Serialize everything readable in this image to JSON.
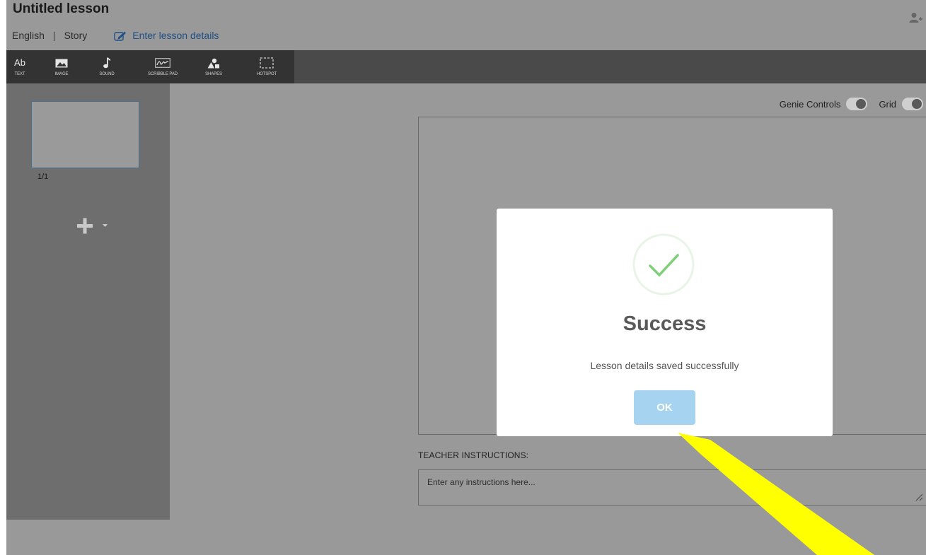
{
  "lesson": {
    "title": "Untitled lesson",
    "language": "English",
    "separator": "|",
    "type": "Story",
    "details_link": "Enter lesson details"
  },
  "toolbar": {
    "text_glyph": "Ab",
    "tools": [
      {
        "label": "TEXT",
        "icon": "text-icon"
      },
      {
        "label": "IMAGE",
        "icon": "image-icon"
      },
      {
        "label": "SOUND",
        "icon": "music-note-icon"
      },
      {
        "label": "SCRIBBLE PAD",
        "icon": "scribble-pad-icon"
      },
      {
        "label": "SHAPES",
        "icon": "shapes-icon"
      },
      {
        "label": "HOTSPOT",
        "icon": "hotspot-icon"
      }
    ]
  },
  "slides": {
    "page_indicator": "1/1"
  },
  "controls": {
    "genie_controls_label": "Genie Controls",
    "grid_label": "Grid"
  },
  "teacher": {
    "label": "TEACHER INSTRUCTIONS:",
    "placeholder": "Enter any instructions here..."
  },
  "dialog": {
    "title": "Success",
    "message": "Lesson details saved successfully",
    "ok_label": "OK",
    "ok_color": "#a6d4f0",
    "check_color": "#7fcf7a"
  },
  "annotation": {
    "arrow_color": "#ffff00"
  }
}
